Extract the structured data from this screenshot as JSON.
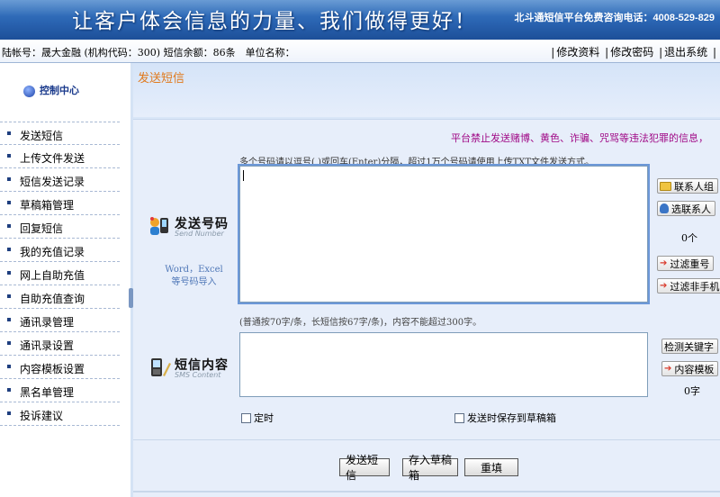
{
  "banner": {
    "slogan": "让客户体会信息的力量、我们做得更好！",
    "hotline": "北斗通短信平台免费咨询电话：4008-529-829"
  },
  "account": {
    "info": "陆帐号：晟大金融 (机构代码：300) 短信余额：86条　单位名称：",
    "links": [
      "修改资料",
      "修改密码",
      "退出系统"
    ]
  },
  "sidebar": {
    "control_center": "控制中心",
    "items": [
      "发送短信",
      "上传文件发送",
      "短信发送记录",
      "草稿箱管理",
      "回复短信",
      "我的充值记录",
      "网上自助充值",
      "自助充值查询",
      "通讯录管理",
      "通讯录设置",
      "内容模板设置",
      "黑名单管理",
      "投诉建议"
    ]
  },
  "main": {
    "title": "发送短信",
    "notice": "平台禁止发送赌博、黄色、诈骗、咒骂等违法犯罪的信息，",
    "numbers_hint": "多个号码请以逗号(,)或回车(Enter)分隔，超过1万个号码请使用上传TXT文件发送方式。",
    "recipients_value": "",
    "send_number_title": "发送号码",
    "send_number_sub": "Send Number",
    "word_excel_hint": "Word，Excel 等号码导入",
    "buttons_right": {
      "contact_group": "联系人组",
      "select_contact": "选联系人",
      "filter_duplicate": "过滤重号",
      "filter_non_mobile": "过滤非手机",
      "check_keywords": "检测关键字",
      "content_template": "内容模板"
    },
    "recipient_count": "0个",
    "length_hint": "(普通按70字/条，长短信按67字/条)，内容不能超过300字。",
    "content_value": "",
    "sms_content_title": "短信内容",
    "sms_content_sub": "SMS Content",
    "char_count": "0字",
    "scheduled_label": "定时",
    "save_draft_on_send_label": "发送时保存到草稿箱",
    "actions": {
      "send": "发送短信",
      "save_draft": "存入草稿箱",
      "reset": "重填"
    }
  }
}
